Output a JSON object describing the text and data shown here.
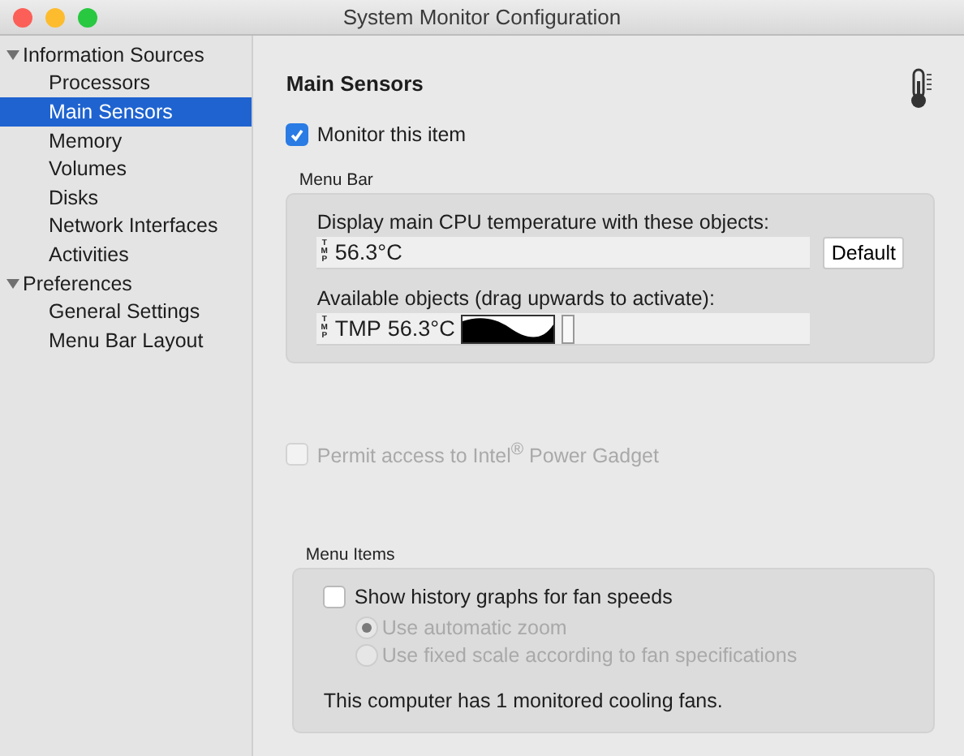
{
  "window": {
    "title": "System Monitor Configuration"
  },
  "sidebar": {
    "groups": [
      {
        "label": "Information Sources",
        "expanded": true,
        "children": [
          {
            "label": "Processors",
            "selected": false
          },
          {
            "label": "Main Sensors",
            "selected": true
          },
          {
            "label": "Memory",
            "selected": false
          },
          {
            "label": "Volumes",
            "selected": false
          },
          {
            "label": "Disks",
            "selected": false
          },
          {
            "label": "Network Interfaces",
            "selected": false
          },
          {
            "label": "Activities",
            "selected": false
          }
        ]
      },
      {
        "label": "Preferences",
        "expanded": true,
        "children": [
          {
            "label": "General Settings",
            "selected": false
          },
          {
            "label": "Menu Bar Layout",
            "selected": false
          }
        ]
      }
    ]
  },
  "main": {
    "title": "Main Sensors",
    "monitor": {
      "label": "Monitor this item",
      "checked": true
    },
    "menu_bar": {
      "title": "Menu Bar",
      "display_label": "Display main CPU temperature with these objects:",
      "active_objects": [
        {
          "kind": "vertical",
          "text": "TMP"
        },
        {
          "kind": "text",
          "text": "56.3°C"
        }
      ],
      "default_button": "Default",
      "available_label": "Available objects (drag upwards to activate):",
      "available_objects": [
        {
          "kind": "vertical",
          "text": "TMP"
        },
        {
          "kind": "text",
          "text": "TMP"
        },
        {
          "kind": "text",
          "text": "56.3°C"
        },
        {
          "kind": "graph"
        },
        {
          "kind": "bar"
        }
      ]
    },
    "power_gadget": {
      "label": "Permit access to Intel$^{®}$ Power Gadget",
      "checked": false,
      "disabled": true
    },
    "menu_items": {
      "title": "Menu Items",
      "history": {
        "label": "Show history graphs for fan speeds",
        "checked": false
      },
      "radios": [
        {
          "label": "Use automatic zoom",
          "selected": true,
          "disabled": true
        },
        {
          "label": "Use fixed scale according to fan specifications",
          "selected": false,
          "disabled": true
        }
      ],
      "note": "This computer has 1 monitored cooling fans."
    }
  }
}
